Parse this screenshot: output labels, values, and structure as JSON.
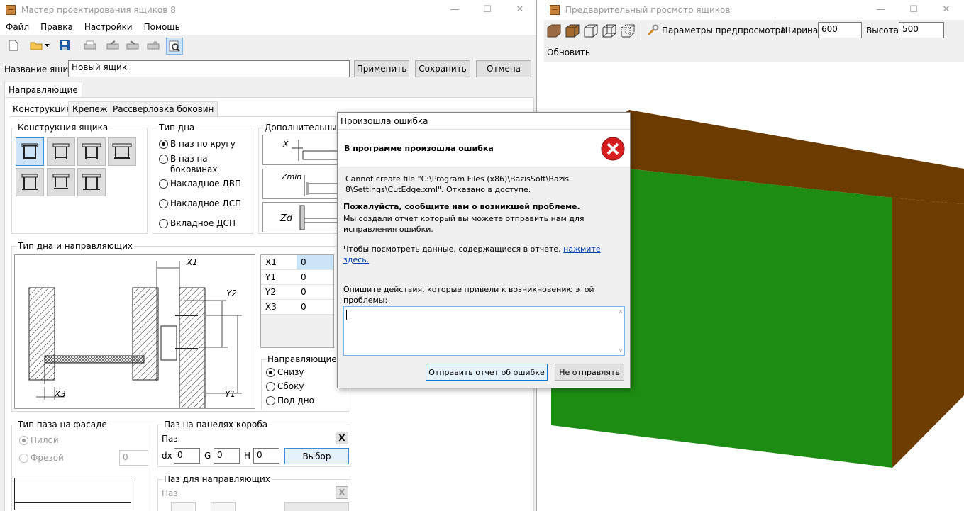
{
  "left_window": {
    "title": "Мастер проектирования ящиков 8",
    "menu": [
      "Файл",
      "Правка",
      "Настройки",
      "Помощь"
    ],
    "box_name_label": "Название ящика",
    "box_name_value": "Новый ящик",
    "apply_label": "Применить",
    "save_label": "Сохранить",
    "cancel_label": "Отмена",
    "main_tab": "Направляющие",
    "sub_tabs": [
      "Конструкция",
      "Крепеж",
      "Рассверловка боковин"
    ],
    "construction_group": "Конструкция ящика",
    "bottom_type_group": "Тип дна",
    "bottom_types": [
      "В паз по кругу",
      "В паз на боковинах",
      "Накладное ДВП",
      "Накладное ДСП",
      "Вкладное ДСП"
    ],
    "bottom_type_selected": "В паз по кругу",
    "additional_group": "Дополнительные",
    "additional_dims": [
      "X",
      "Zmin",
      "Zd"
    ],
    "guides_group": "Тип дна и направляющих",
    "diagram_labels": {
      "x1": "X1",
      "y2": "Y2",
      "y1": "Y1",
      "x3": "X3"
    },
    "params": [
      {
        "name": "X1",
        "value": "0"
      },
      {
        "name": "Y1",
        "value": "0"
      },
      {
        "name": "Y2",
        "value": "0"
      },
      {
        "name": "X3",
        "value": "0"
      }
    ],
    "guide_dir_group": "Направляющие",
    "guide_dirs": [
      "Снизу",
      "Сбоку",
      "Под дно"
    ],
    "guide_dir_selected": "Снизу",
    "facade_group": "Тип паза на фасаде",
    "facade_options": [
      "Пилой",
      "Фрезой"
    ],
    "facade_value": "0",
    "panel_groove_group": "Паз на панелях короба",
    "groove_label": "Паз",
    "groove_fields": [
      {
        "label": "dx",
        "value": "0"
      },
      {
        "label": "G",
        "value": "0"
      },
      {
        "label": "H",
        "value": "0"
      }
    ],
    "choose_label": "Выбор",
    "x_label": "X",
    "guides_groove_group": "Паз для направляющих",
    "guides_groove_label": "Паз"
  },
  "right_window": {
    "title": "Предварительный просмотр ящиков",
    "preview_params_label": "Параметры предпросмотра",
    "width_label": "Ширина",
    "width_value": "600",
    "height_label": "Высота",
    "height_value": "500",
    "refresh_label": "Обновить",
    "colors": {
      "top": "#6b3b00",
      "front": "#1c8c12",
      "side": "#6e3d02",
      "background": "#ffffff"
    }
  },
  "dialog": {
    "title": "Произошла ошибка",
    "header": "В программе произошла ошибка",
    "message": "Cannot create file \"C:\\Program Files (x86)\\BazisSoft\\Bazis 8\\Settings\\CutEdge.xml\". Отказано в доступе.",
    "please_report": "Пожалуйста, сообщите нам о возникшей проблеме.",
    "report_created": "Мы создали отчет который вы можете отправить нам для исправления ошибки.",
    "view_data": "Чтобы посмотреть данные, содержащиеся в отчете,",
    "view_link": "нажмите здесь.",
    "describe": "Опишите действия, которые привели к возникновению этой проблемы:",
    "send_label": "Отправить отчет об ошибке",
    "dont_send_label": "Не отправлять"
  }
}
